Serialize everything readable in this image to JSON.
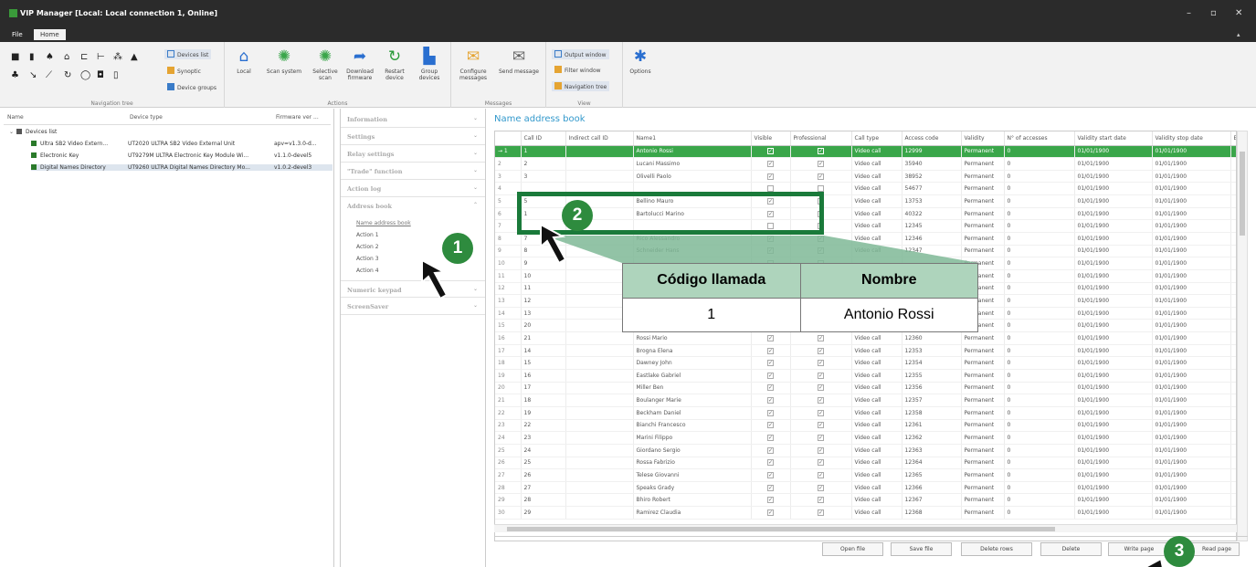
{
  "app": {
    "title": "VIP Manager [Local: Local connection 1, Online]",
    "win_min": "–",
    "win_max": "▫",
    "win_close": "✕",
    "ribbon_collapse": "▴"
  },
  "menu": {
    "file": "File",
    "home": "Home"
  },
  "ribbon": {
    "nav": {
      "devices_list": "Devices list",
      "synoptic": "Synoptic",
      "device_groups": "Device groups",
      "label": "Navigation tree"
    },
    "actions": {
      "local": "Local",
      "scan_system": "Scan system",
      "selective_scan": "Selective scan",
      "download_firmware": "Download firmware",
      "restart_device": "Restart device",
      "group_devices": "Group devices",
      "label": "Actions"
    },
    "messages": {
      "configure": "Configure messages",
      "send": "Send message",
      "label": "Messages"
    },
    "view": {
      "output": "Output window",
      "filter": "Filter window",
      "navtree": "Navigation tree",
      "label": "View"
    },
    "options": {
      "label": "Options"
    }
  },
  "tree": {
    "headers": [
      "Name",
      "Device type",
      "Firmware ver ..."
    ],
    "root": "Devices list",
    "rows": [
      {
        "name": "Ultra SB2 Video Extern...",
        "type": "UT2020 ULTRA SB2 Video External Unit",
        "fw": "apv=v1.3.0-d..."
      },
      {
        "name": "Electronic Key",
        "type": "UT9279M ULTRA Electronic Key Module Wi...",
        "fw": "v1.1.0-devel5"
      },
      {
        "name": "Digital Names Directory",
        "type": "UT9260 ULTRA Digital Names Directory Mo...",
        "fw": "v1.0.2-devel3"
      }
    ]
  },
  "sections": {
    "information": "Information",
    "settings": "Settings",
    "relay": "Relay settings",
    "trade": "\"Trade\" function",
    "action_log": "Action log",
    "address_book": "Address book",
    "sub": [
      "Name address book",
      "Action 1",
      "Action 2",
      "Action 3",
      "Action 4"
    ],
    "numeric": "Numeric keypad",
    "screensaver": "ScreenSaver"
  },
  "table": {
    "title": "Name address book",
    "columns": [
      "",
      "Call ID",
      "Indirect call ID",
      "Name1",
      "Visible",
      "Professional",
      "Call type",
      "Access code",
      "Validity",
      "N° of accesses",
      "Validity start date",
      "Validity stop date",
      "Ena"
    ],
    "rows": [
      [
        "→ 1",
        "1",
        "",
        "Antonio Rossi",
        "✓",
        "✓",
        "Video call",
        "12999",
        "Permanent",
        "0",
        "01/01/1900",
        "01/01/1900"
      ],
      [
        "2",
        "2",
        "",
        "Lucani Massimo",
        "✓",
        "✓",
        "Video call",
        "35940",
        "Permanent",
        "0",
        "01/01/1900",
        "01/01/1900"
      ],
      [
        "3",
        "3",
        "",
        "Olivelli Paolo",
        "✓",
        "✓",
        "Video call",
        "38952",
        "Permanent",
        "0",
        "01/01/1900",
        "01/01/1900"
      ],
      [
        "4",
        "",
        "",
        "",
        "",
        "",
        "Video call",
        "54677",
        "Permanent",
        "0",
        "01/01/1900",
        "01/01/1900"
      ],
      [
        "5",
        "5",
        "",
        "Bellino Mauro",
        "✓",
        "",
        "Video call",
        "13753",
        "Permanent",
        "0",
        "01/01/1900",
        "01/01/1900"
      ],
      [
        "6",
        "1",
        "",
        "Bartolucci Marino",
        "✓",
        "",
        "Video call",
        "40322",
        "Permanent",
        "0",
        "01/01/1900",
        "01/01/1900"
      ],
      [
        "7",
        "",
        "",
        "",
        "",
        "",
        "Video call",
        "12345",
        "Permanent",
        "0",
        "01/01/1900",
        "01/01/1900"
      ],
      [
        "8",
        "7",
        "",
        "Rico Alessandro",
        "✓",
        "✓",
        "Video call",
        "12346",
        "Permanent",
        "0",
        "01/01/1900",
        "01/01/1900"
      ],
      [
        "9",
        "8",
        "",
        "Schneider Hans",
        "✓",
        "✓",
        "Video call",
        "12347",
        "Permanent",
        "0",
        "01/01/1900",
        "01/01/1900"
      ],
      [
        "10",
        "9",
        "",
        "",
        "",
        "",
        "",
        "",
        "Permanent",
        "0",
        "01/01/1900",
        "01/01/1900"
      ],
      [
        "11",
        "10",
        "",
        "",
        "",
        "",
        "",
        "",
        "Permanent",
        "0",
        "01/01/1900",
        "01/01/1900"
      ],
      [
        "12",
        "11",
        "",
        "",
        "",
        "",
        "",
        "",
        "Permanent",
        "0",
        "01/01/1900",
        "01/01/1900"
      ],
      [
        "13",
        "12",
        "",
        "",
        "",
        "",
        "",
        "",
        "Permanent",
        "0",
        "01/01/1900",
        "01/01/1900"
      ],
      [
        "14",
        "13",
        "",
        "",
        "",
        "",
        "",
        "",
        "Permanent",
        "0",
        "01/01/1900",
        "01/01/1900"
      ],
      [
        "15",
        "20",
        "",
        "",
        "",
        "",
        "",
        "",
        "Permanent",
        "0",
        "01/01/1900",
        "01/01/1900"
      ],
      [
        "16",
        "21",
        "",
        "Rossi Mario",
        "✓",
        "✓",
        "Video call",
        "12360",
        "Permanent",
        "0",
        "01/01/1900",
        "01/01/1900"
      ],
      [
        "17",
        "14",
        "",
        "Brogna Elena",
        "✓",
        "✓",
        "Video call",
        "12353",
        "Permanent",
        "0",
        "01/01/1900",
        "01/01/1900"
      ],
      [
        "18",
        "15",
        "",
        "Dawney John",
        "✓",
        "✓",
        "Video call",
        "12354",
        "Permanent",
        "0",
        "01/01/1900",
        "01/01/1900"
      ],
      [
        "19",
        "16",
        "",
        "Eastlake Gabriel",
        "✓",
        "✓",
        "Video call",
        "12355",
        "Permanent",
        "0",
        "01/01/1900",
        "01/01/1900"
      ],
      [
        "20",
        "17",
        "",
        "Miller Ben",
        "✓",
        "✓",
        "Video call",
        "12356",
        "Permanent",
        "0",
        "01/01/1900",
        "01/01/1900"
      ],
      [
        "21",
        "18",
        "",
        "Boulanger Marie",
        "✓",
        "✓",
        "Video call",
        "12357",
        "Permanent",
        "0",
        "01/01/1900",
        "01/01/1900"
      ],
      [
        "22",
        "19",
        "",
        "Beckham Daniel",
        "✓",
        "✓",
        "Video call",
        "12358",
        "Permanent",
        "0",
        "01/01/1900",
        "01/01/1900"
      ],
      [
        "23",
        "22",
        "",
        "Bianchi Francesco",
        "✓",
        "✓",
        "Video call",
        "12361",
        "Permanent",
        "0",
        "01/01/1900",
        "01/01/1900"
      ],
      [
        "24",
        "23",
        "",
        "Marini Filippo",
        "✓",
        "✓",
        "Video call",
        "12362",
        "Permanent",
        "0",
        "01/01/1900",
        "01/01/1900"
      ],
      [
        "25",
        "24",
        "",
        "Giordano Sergio",
        "✓",
        "✓",
        "Video call",
        "12363",
        "Permanent",
        "0",
        "01/01/1900",
        "01/01/1900"
      ],
      [
        "26",
        "25",
        "",
        "Rossa Fabrizio",
        "✓",
        "✓",
        "Video call",
        "12364",
        "Permanent",
        "0",
        "01/01/1900",
        "01/01/1900"
      ],
      [
        "27",
        "26",
        "",
        "Telese Giovanni",
        "✓",
        "✓",
        "Video call",
        "12365",
        "Permanent",
        "0",
        "01/01/1900",
        "01/01/1900"
      ],
      [
        "28",
        "27",
        "",
        "Speaks Grady",
        "✓",
        "✓",
        "Video call",
        "12366",
        "Permanent",
        "0",
        "01/01/1900",
        "01/01/1900"
      ],
      [
        "29",
        "28",
        "",
        "Bhiro Robert",
        "✓",
        "✓",
        "Video call",
        "12367",
        "Permanent",
        "0",
        "01/01/1900",
        "01/01/1900"
      ],
      [
        "30",
        "29",
        "",
        "Ramirez Claudia",
        "✓",
        "✓",
        "Video call",
        "12368",
        "Permanent",
        "0",
        "01/01/1900",
        "01/01/1900"
      ]
    ]
  },
  "buttons": {
    "open": "Open file",
    "save": "Save file",
    "delete_rows": "Delete rows",
    "delete": "Delete",
    "write": "Write page",
    "read": "Read page"
  },
  "callout": {
    "h1": "Código llamada",
    "h2": "Nombre",
    "v1": "1",
    "v2": "Antonio Rossi"
  },
  "badges": {
    "b1": "1",
    "b2": "2",
    "b3": "3"
  },
  "colors": {
    "accent_green": "#3aa64a",
    "annotation_green": "#1a7a3a",
    "title_blue": "#3399cc"
  }
}
